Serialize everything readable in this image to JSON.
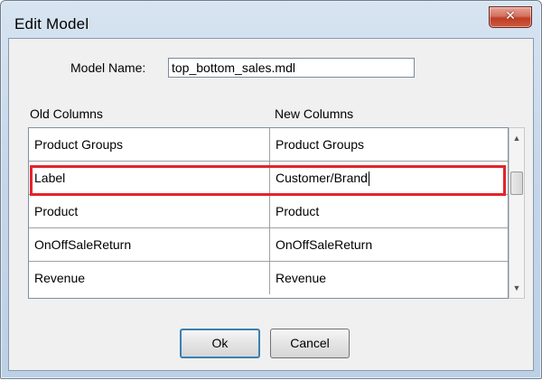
{
  "window": {
    "title": "Edit Model",
    "close_glyph": "✕"
  },
  "model": {
    "label": "Model Name:",
    "value": "top_bottom_sales.mdl"
  },
  "columns": {
    "old_header": "Old Columns",
    "new_header": "New Columns"
  },
  "rows": [
    {
      "old": "Product Groups",
      "new": "Product Groups"
    },
    {
      "old": "Label",
      "new": "Customer/Brand"
    },
    {
      "old": "Product",
      "new": "Product"
    },
    {
      "old": "OnOffSaleReturn",
      "new": "OnOffSaleReturn"
    },
    {
      "old": "Revenue",
      "new": "Revenue"
    }
  ],
  "scrollbar": {
    "up_glyph": "▲",
    "down_glyph": "▼"
  },
  "buttons": {
    "ok": "Ok",
    "cancel": "Cancel"
  },
  "colors": {
    "highlight": "#e3242b",
    "close_button": "#c4483a"
  }
}
